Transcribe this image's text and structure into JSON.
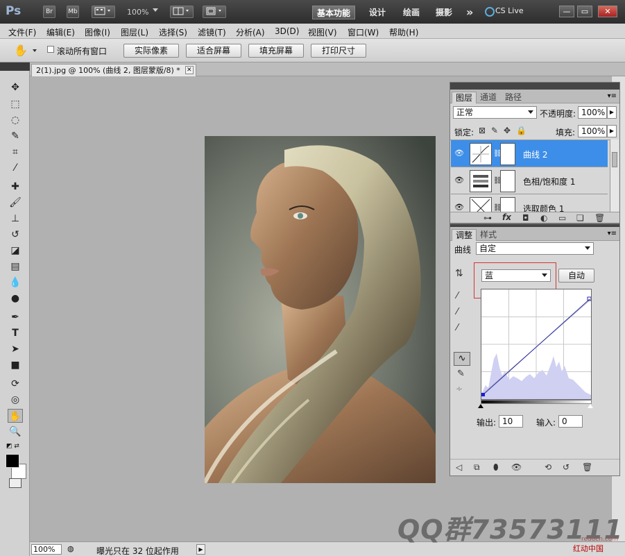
{
  "titlebar": {
    "app_logo": "Ps",
    "bridge_btn": "Br",
    "minibridge_btn": "Mb",
    "zoom": "100%",
    "workspaces": [
      "基本功能",
      "设计",
      "绘画",
      "摄影"
    ],
    "more": "»",
    "cs_live": "CS Live",
    "window_controls": [
      "—",
      "▭",
      "✕"
    ]
  },
  "menu": [
    "文件(F)",
    "编辑(E)",
    "图像(I)",
    "图层(L)",
    "选择(S)",
    "滤镜(T)",
    "分析(A)",
    "3D(D)",
    "视图(V)",
    "窗口(W)",
    "帮助(H)"
  ],
  "options": {
    "scroll_all": "滚动所有窗口",
    "buttons": [
      "实际像素",
      "适合屏幕",
      "填充屏幕",
      "打印尺寸"
    ]
  },
  "document": {
    "tab_title": "2(1).jpg @ 100% (曲线 2, 图层蒙版/8) *",
    "close": "✕"
  },
  "status": {
    "zoom": "100%",
    "message": "曝光只在 32 位起作用"
  },
  "layers_panel": {
    "tabs": [
      "图层",
      "通道",
      "路径"
    ],
    "blend_mode": "正常",
    "opacity_label": "不透明度:",
    "opacity": "100%",
    "lock_label": "锁定:",
    "fill_label": "填充:",
    "fill": "100%",
    "layers": [
      {
        "name": "曲线 2",
        "selected": true
      },
      {
        "name": "色相/饱和度 1",
        "selected": false
      },
      {
        "name": "选取颜色 1",
        "selected": false
      }
    ]
  },
  "adjust_panel": {
    "tabs": [
      "调整",
      "样式"
    ],
    "curves_label": "曲线",
    "preset": "自定",
    "channel": "蓝",
    "auto_btn": "自动",
    "output_label": "输出:",
    "output": "10",
    "input_label": "输入:",
    "input": "0"
  },
  "watermark": "QQ群73573111",
  "site": "redocn.com",
  "site_logo": "红动中国",
  "colors": {
    "highlight": "#3d8ee8",
    "callout": "#d33333"
  }
}
